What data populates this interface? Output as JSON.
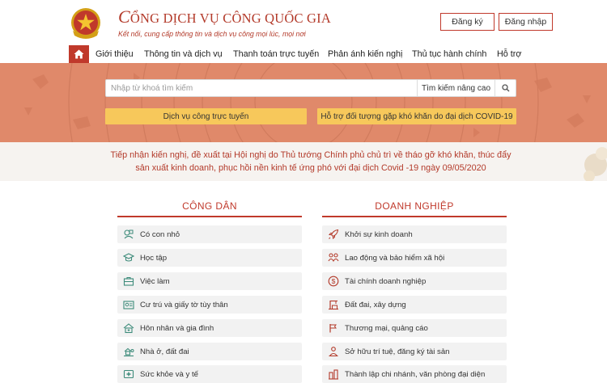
{
  "header": {
    "title_first": "C",
    "title_rest": "ỔNG DỊCH VỤ CÔNG QUỐC GIA",
    "subtitle": "Kết nối, cung cấp thông tin và dịch vụ công mọi lúc, mọi nơi",
    "register_label": "Đăng ký",
    "login_label": "Đăng nhập"
  },
  "nav": {
    "items": [
      {
        "label": "Giới thiệu"
      },
      {
        "label": "Thông tin và dịch vụ"
      },
      {
        "label": "Thanh toán trực tuyến"
      },
      {
        "label": "Phản ánh kiến nghị"
      },
      {
        "label": "Thủ tục hành chính"
      },
      {
        "label": "Hỗ trợ"
      }
    ]
  },
  "search": {
    "placeholder": "Nhập từ khoá tìm kiếm",
    "advanced_label": "Tìm kiếm nâng cao",
    "icon": "search-icon"
  },
  "hero": {
    "online_services_label": "Dịch vụ công trực tuyến",
    "covid_support_label": "Hỗ trợ đối tượng gặp khó khăn do đại dịch COVID-19"
  },
  "announcement": {
    "text": "Tiếp nhận kiến nghị, đề xuất tại Hội nghị do Thủ tướng Chính phủ chủ trì về tháo gỡ khó khăn, thúc đẩy sản xuất kinh doanh, phục hồi nền kinh tế ứng phó với đại dịch Covid -19 ngày 09/05/2020"
  },
  "citizen": {
    "title": "CÔNG DÂN",
    "items": [
      {
        "label": "Có con nhỏ",
        "icon": "baby-icon"
      },
      {
        "label": "Học tập",
        "icon": "graduation-cap-icon"
      },
      {
        "label": "Việc làm",
        "icon": "briefcase-icon"
      },
      {
        "label": "Cư trú và giấy tờ tùy thân",
        "icon": "id-card-icon"
      },
      {
        "label": "Hôn nhân và gia đình",
        "icon": "family-home-icon"
      },
      {
        "label": "Nhà ở, đất đai",
        "icon": "house-land-icon"
      },
      {
        "label": "Sức khỏe và y tế",
        "icon": "health-icon"
      }
    ]
  },
  "business": {
    "title": "DOANH NGHIỆP",
    "items": [
      {
        "label": "Khởi sự kinh doanh",
        "icon": "rocket-icon"
      },
      {
        "label": "Lao động và bảo hiểm xã hội",
        "icon": "workers-icon"
      },
      {
        "label": "Tài chính doanh nghiệp",
        "icon": "dollar-icon"
      },
      {
        "label": "Đất đai, xây dựng",
        "icon": "construction-icon"
      },
      {
        "label": "Thương mại, quảng cáo",
        "icon": "megaphone-icon"
      },
      {
        "label": "Sở hữu trí tuệ, đăng ký tài sản",
        "icon": "intellectual-property-icon"
      },
      {
        "label": "Thành lập chi nhánh, văn phòng đại diện",
        "icon": "branch-office-icon"
      }
    ]
  },
  "colors": {
    "primary": "#c0392b",
    "hero_bg": "#e0896a",
    "button_yellow": "#f7c85b",
    "item_bg": "#f2f2f2"
  }
}
